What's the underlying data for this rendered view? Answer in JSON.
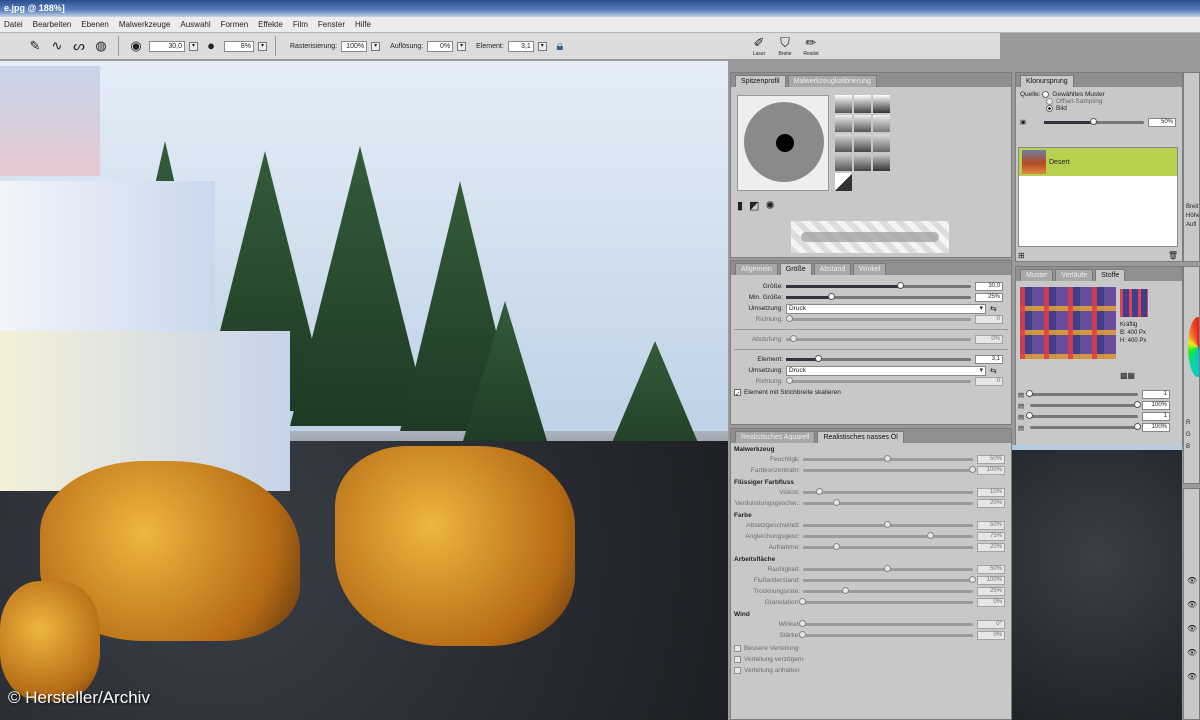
{
  "title_bar": {
    "text": "e.jpg @ 188%]"
  },
  "menu": {
    "items": [
      "Datei",
      "Bearbeiten",
      "Ebenen",
      "Malwerkzeuge",
      "Auswahl",
      "Formen",
      "Effekte",
      "Film",
      "Fenster",
      "Hilfe"
    ]
  },
  "options_bar": {
    "size_value": "30,0",
    "opacity_value": "8%",
    "rasterization_label": "Rasterisierung:",
    "rasterization_value": "100%",
    "resolution_label": "Auflösung:",
    "resolution_value": "0%",
    "element_label": "Element:",
    "element_value": "3,1"
  },
  "presets": {
    "items": [
      "Lasur",
      "Breite",
      "Realist"
    ]
  },
  "copyright": "© Hersteller/Archiv",
  "tip_panel": {
    "tabs": [
      "Spitzenprofil",
      "Malwerkzeugkalibrierung"
    ]
  },
  "size_panel": {
    "tabs": [
      "Allgemein",
      "Größe",
      "Abstand",
      "Winkel"
    ],
    "groesse_label": "Größe:",
    "groesse_value": "30,0",
    "groesse_fraction": 0.62,
    "min_groesse_label": "Min. Größe:",
    "min_groesse_value": "25%",
    "min_groesse_fraction": 0.25,
    "umsetzung_label": "Umsetzung:",
    "umsetzung_value": "Druck",
    "richtung_label": "Richtung:",
    "richtung_value": "0",
    "abstufung_label": "Abstufung:",
    "abstufung_value": "0%",
    "element_label": "Element:",
    "element_value": "3,1",
    "element_fraction": 0.18,
    "umsetzung2_label": "Umsetzung:",
    "umsetzung2_value": "Druck",
    "richtung2_label": "Richtung:",
    "richtung2_value": "0",
    "element_scale_label": "Element mit Strichbreite skalieren"
  },
  "watercolor_panel": {
    "tabs": [
      "Realistisches Aquarell",
      "Realistisches nasses Öl"
    ],
    "sections": [
      {
        "title": "Malwerkzeug",
        "rows": [
          {
            "label": "Feuchtigk:",
            "value": "50%",
            "fraction": 0.5
          },
          {
            "label": "Farbkonzentratn:",
            "value": "100%",
            "fraction": 1.0
          }
        ]
      },
      {
        "title": "Flüssiger Farbfluss",
        "rows": [
          {
            "label": "Viskos:",
            "value": "10%",
            "fraction": 0.1
          },
          {
            "label": "Verdunstungsgeschw.:",
            "value": "20%",
            "fraction": 0.2
          }
        ]
      },
      {
        "title": "Farbe",
        "rows": [
          {
            "label": "Absetzgeschwindi:",
            "value": "50%",
            "fraction": 0.5
          },
          {
            "label": "Angleichungsgesc:",
            "value": "75%",
            "fraction": 0.75
          },
          {
            "label": "Aufnahme:",
            "value": "20%",
            "fraction": 0.2
          }
        ]
      },
      {
        "title": "Arbeitsfläche",
        "rows": [
          {
            "label": "Rauhigkeit:",
            "value": "50%",
            "fraction": 0.5
          },
          {
            "label": "Flußwiderstand:",
            "value": "100%",
            "fraction": 1.0
          },
          {
            "label": "Trocknungsrate:",
            "value": "25%",
            "fraction": 0.25
          },
          {
            "label": "Granulation:",
            "value": "0%",
            "fraction": 0.0
          }
        ]
      },
      {
        "title": "Wind",
        "rows": [
          {
            "label": "Winkel:",
            "value": "0°",
            "fraction": 0.0
          },
          {
            "label": "Stärke:",
            "value": "0%",
            "fraction": 0.0
          }
        ]
      }
    ],
    "checks": [
      "Bessere Verteilung",
      "Verteilung verzögern",
      "Verteilung anhalten"
    ]
  },
  "clone_panel": {
    "tab": "Klonursprung",
    "source_label": "Quelle:",
    "options": [
      "Gewähltes Muster",
      "Offset-Sampling",
      "Bild"
    ],
    "selected_option": "Bild",
    "opacity_value": "50%",
    "opacity_fraction": 0.5,
    "list_item": "Desert"
  },
  "patterns_panel": {
    "tabs": [
      "Muster",
      "Verläufe",
      "Stoffe"
    ],
    "info_title": "Kräftig",
    "info_b": "B: 400 Px",
    "info_h": "H: 400 Px",
    "rows": [
      {
        "value": "1",
        "fraction": 0.0
      },
      {
        "value": "100%",
        "fraction": 1.0
      },
      {
        "value": "1",
        "fraction": 0.0
      },
      {
        "value": "100%",
        "fraction": 1.0
      }
    ]
  },
  "right_edge": {
    "text_lines": [
      "Breit",
      "Höhe",
      "Aufl"
    ],
    "letters": [
      "R",
      "G",
      "B"
    ]
  }
}
